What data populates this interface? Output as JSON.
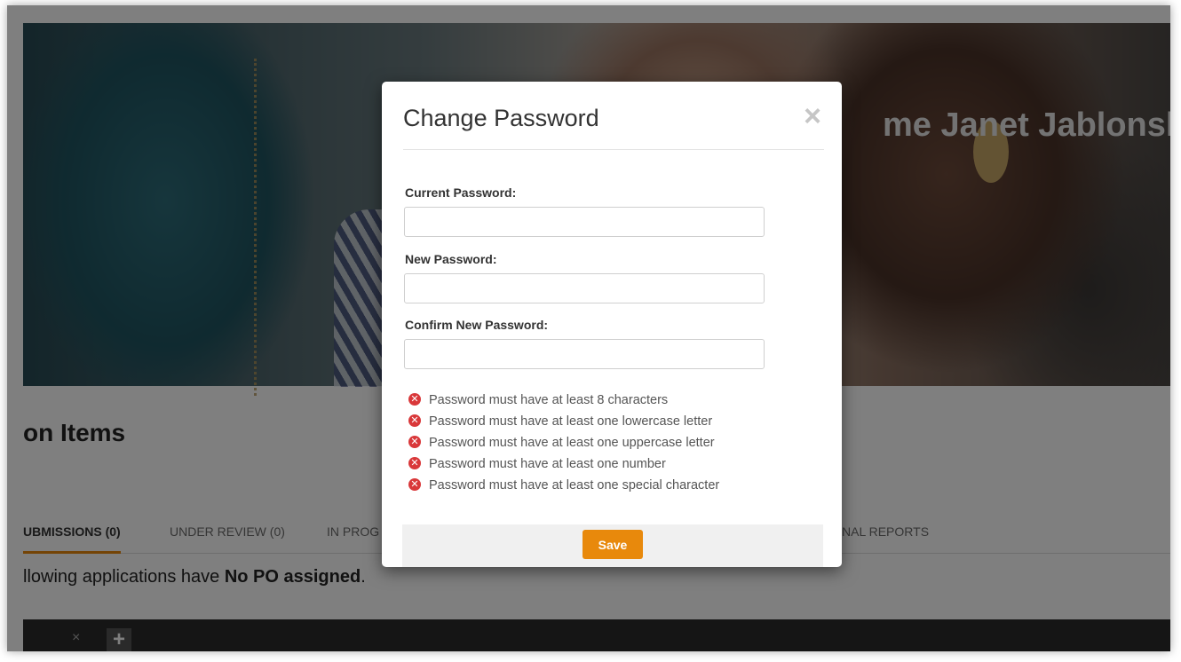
{
  "hero": {
    "title": "me Janet Jablonsk"
  },
  "page": {
    "heading": "on Items",
    "tabs": [
      {
        "label": "UBMISSIONS (0)",
        "active": true
      },
      {
        "label": "UNDER REVIEW (0)",
        "active": false
      },
      {
        "label": "IN PROG",
        "active": false
      },
      {
        "label": "NAL REPORTS",
        "active": false
      }
    ],
    "notice_prefix": "llowing applications have ",
    "notice_bold": "No PO assigned",
    "notice_suffix": ".",
    "bar_close": "×",
    "bar_add": "+"
  },
  "modal": {
    "title": "Change Password",
    "close_symbol": "×",
    "current_label": "Current Password:",
    "current_value": "",
    "new_label": "New Password:",
    "new_value": "",
    "confirm_label": "Confirm New Password:",
    "confirm_value": "",
    "rules": [
      "Password must have at least 8 characters",
      "Password must have at least one lowercase letter",
      "Password must have at least one uppercase letter",
      "Password must have at least one number",
      "Password must have at least one special character"
    ],
    "rule_icon": "x-circle-icon",
    "rule_icon_color": "#d9383a",
    "save_label": "Save",
    "accent_color": "#e8890c"
  }
}
